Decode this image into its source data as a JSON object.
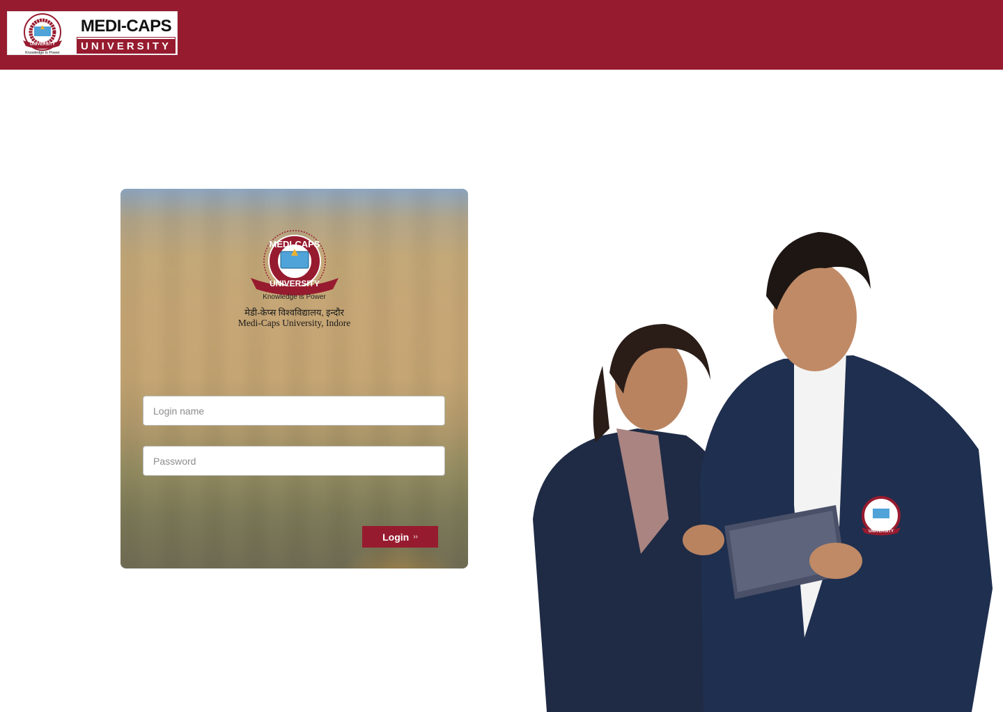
{
  "header": {
    "brand_name": "MEDI-CAPS",
    "brand_sub": "UNIVERSITY",
    "brand_tagline": "Knowledge is Power",
    "bg_color": "#971b2f"
  },
  "card": {
    "seal_top": "MEDI-CAPS",
    "seal_ribbon": "UNIVERSITY",
    "tagline": "Knowledge is Power",
    "hindi_name": "मेडी-केप्स विश्वविद्यालय, इन्दौर",
    "english_name": "Medi-Caps University, Indore"
  },
  "form": {
    "login_placeholder": "Login name",
    "login_value": "",
    "password_placeholder": "Password",
    "password_value": "",
    "submit_label": "Login",
    "submit_icon": "double-chevron-right-icon"
  },
  "hero": {
    "description": "students-with-tablet-photo",
    "badge_seal_ribbon": "UNIVERSITY"
  }
}
